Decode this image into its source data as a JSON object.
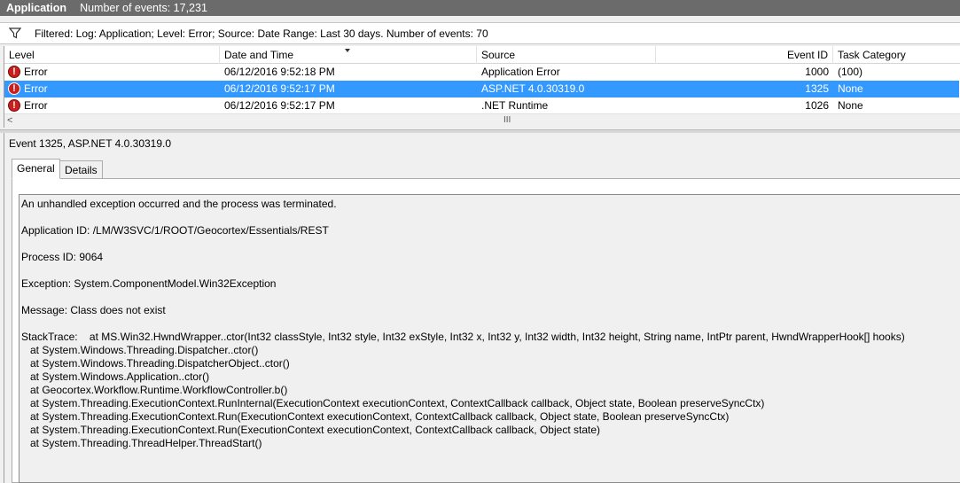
{
  "titlebar": {
    "log_name": "Application",
    "event_count": "Number of events: 17,231"
  },
  "filter": {
    "icon": "filter-icon",
    "text": "Filtered: Log: Application; Level: Error; Source: Date Range: Last 30 days. Number of events: 70"
  },
  "grid": {
    "columns": {
      "level": "Level",
      "date": "Date and Time",
      "source": "Source",
      "event_id": "Event ID",
      "task": "Task Category"
    },
    "rows": [
      {
        "level": "Error",
        "date": "06/12/2016 9:52:18 PM",
        "source": "Application Error",
        "event_id": "1000",
        "task": "(100)",
        "selected": false
      },
      {
        "level": "Error",
        "date": "06/12/2016 9:52:17 PM",
        "source": "ASP.NET 4.0.30319.0",
        "event_id": "1325",
        "task": "None",
        "selected": true
      },
      {
        "level": "Error",
        "date": "06/12/2016 9:52:17 PM",
        "source": ".NET Runtime",
        "event_id": "1026",
        "task": "None",
        "selected": false
      }
    ],
    "scroll_left_glyph": "<",
    "scroll_grip_glyph": "III"
  },
  "detail": {
    "title": "Event 1325, ASP.NET 4.0.30319.0",
    "tabs": {
      "general": "General",
      "details": "Details"
    },
    "message": {
      "line1": "An unhandled exception occurred and the process was terminated.",
      "line2": "Application ID: /LM/W3SVC/1/ROOT/Geocortex/Essentials/REST",
      "line3": "Process ID: 9064",
      "line4": "Exception: System.ComponentModel.Win32Exception",
      "line5": "Message: Class does not exist",
      "stack": [
        "StackTrace:    at MS.Win32.HwndWrapper..ctor(Int32 classStyle, Int32 style, Int32 exStyle, Int32 x, Int32 y, Int32 width, Int32 height, String name, IntPtr parent, HwndWrapperHook[] hooks)",
        "   at System.Windows.Threading.Dispatcher..ctor()",
        "   at System.Windows.Threading.DispatcherObject..ctor()",
        "   at System.Windows.Application..ctor()",
        "   at Geocortex.Workflow.Runtime.WorkflowController.b()",
        "   at System.Threading.ExecutionContext.RunInternal(ExecutionContext executionContext, ContextCallback callback, Object state, Boolean preserveSyncCtx)",
        "   at System.Threading.ExecutionContext.Run(ExecutionContext executionContext, ContextCallback callback, Object state, Boolean preserveSyncCtx)",
        "   at System.Threading.ExecutionContext.Run(ExecutionContext executionContext, ContextCallback callback, Object state)",
        "   at System.Threading.ThreadHelper.ThreadStart()"
      ]
    }
  },
  "colors": {
    "selection": "#3399ff",
    "titlebar": "#6b6b6b",
    "error_icon": "#c9201d"
  }
}
